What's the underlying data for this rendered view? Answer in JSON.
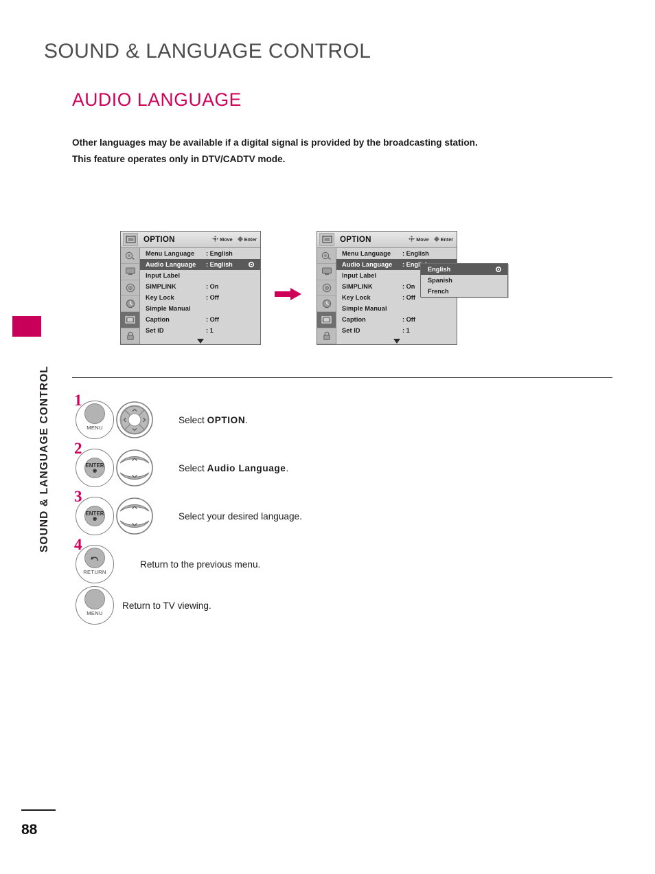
{
  "page": {
    "chapter_title": "SOUND & LANGUAGE CONTROL",
    "section_title": "AUDIO LANGUAGE",
    "side_tab_title": "SOUND & LANGUAGE CONTROL",
    "page_number": "88",
    "accent_color": "#cf0058",
    "text_color": "#231f20"
  },
  "intro": {
    "line1": "Other languages may be available if a digital signal is provided by the broadcasting station.",
    "line2": "This feature operates only in DTV/CADTV mode."
  },
  "osd": {
    "title": "OPTION",
    "hints": [
      {
        "icon": "dpad-move-icon",
        "label": "Move"
      },
      {
        "icon": "enter-dot-icon",
        "label": "Enter"
      }
    ],
    "category_icons": [
      "picture-icon",
      "screen-icon",
      "audio-icon",
      "time-icon",
      "option-icon",
      "lock-icon"
    ],
    "selected_category_index": 4,
    "rows": [
      {
        "label": "Menu Language",
        "value": ": English",
        "highlight": false,
        "radio": false
      },
      {
        "label": "Audio Language",
        "value": ": English",
        "highlight": true,
        "radio": true
      },
      {
        "label": "Input Label",
        "value": "",
        "highlight": false,
        "radio": false
      },
      {
        "label": "SIMPLINK",
        "value": ": On",
        "highlight": false,
        "radio": false
      },
      {
        "label": "Key Lock",
        "value": ": Off",
        "highlight": false,
        "radio": false
      },
      {
        "label": "Simple Manual",
        "value": "",
        "highlight": false,
        "radio": false
      },
      {
        "label": "Caption",
        "value": ": Off",
        "highlight": false,
        "radio": false
      },
      {
        "label": "Set ID",
        "value": ": 1",
        "highlight": false,
        "radio": false
      }
    ],
    "scroll_indicator": "more-down-icon"
  },
  "dropdown": {
    "items": [
      {
        "label": "English",
        "selected": true
      },
      {
        "label": "Spanish",
        "selected": false
      },
      {
        "label": "French",
        "selected": false
      }
    ]
  },
  "flow": {
    "arrow_icon": "right-arrow-icon",
    "arrow_color": "#cf0058"
  },
  "steps": [
    {
      "number": "1",
      "button_label": "MENU",
      "button_cap": "",
      "nav_icon": "dpad-4way-icon",
      "text_prefix": "Select ",
      "text_bold": "OPTION",
      "text_suffix": "."
    },
    {
      "number": "2",
      "button_label": "",
      "button_cap": "ENTER",
      "nav_icon": "updown-rocker-icon",
      "text_prefix": "Select ",
      "text_bold": "Audio Language",
      "text_suffix": "."
    },
    {
      "number": "3",
      "button_label": "",
      "button_cap": "ENTER",
      "nav_icon": "updown-rocker-icon",
      "text_prefix": "Select your desired language.",
      "text_bold": "",
      "text_suffix": ""
    },
    {
      "number": "4",
      "button_label": "RETURN",
      "button_cap": "return-arrow-icon",
      "nav_icon": "",
      "text_prefix": "Return to the previous menu.",
      "text_bold": "",
      "text_suffix": ""
    },
    {
      "number": "",
      "button_label": "MENU",
      "button_cap": "",
      "nav_icon": "",
      "text_prefix": "Return to TV viewing.",
      "text_bold": "",
      "text_suffix": ""
    }
  ]
}
